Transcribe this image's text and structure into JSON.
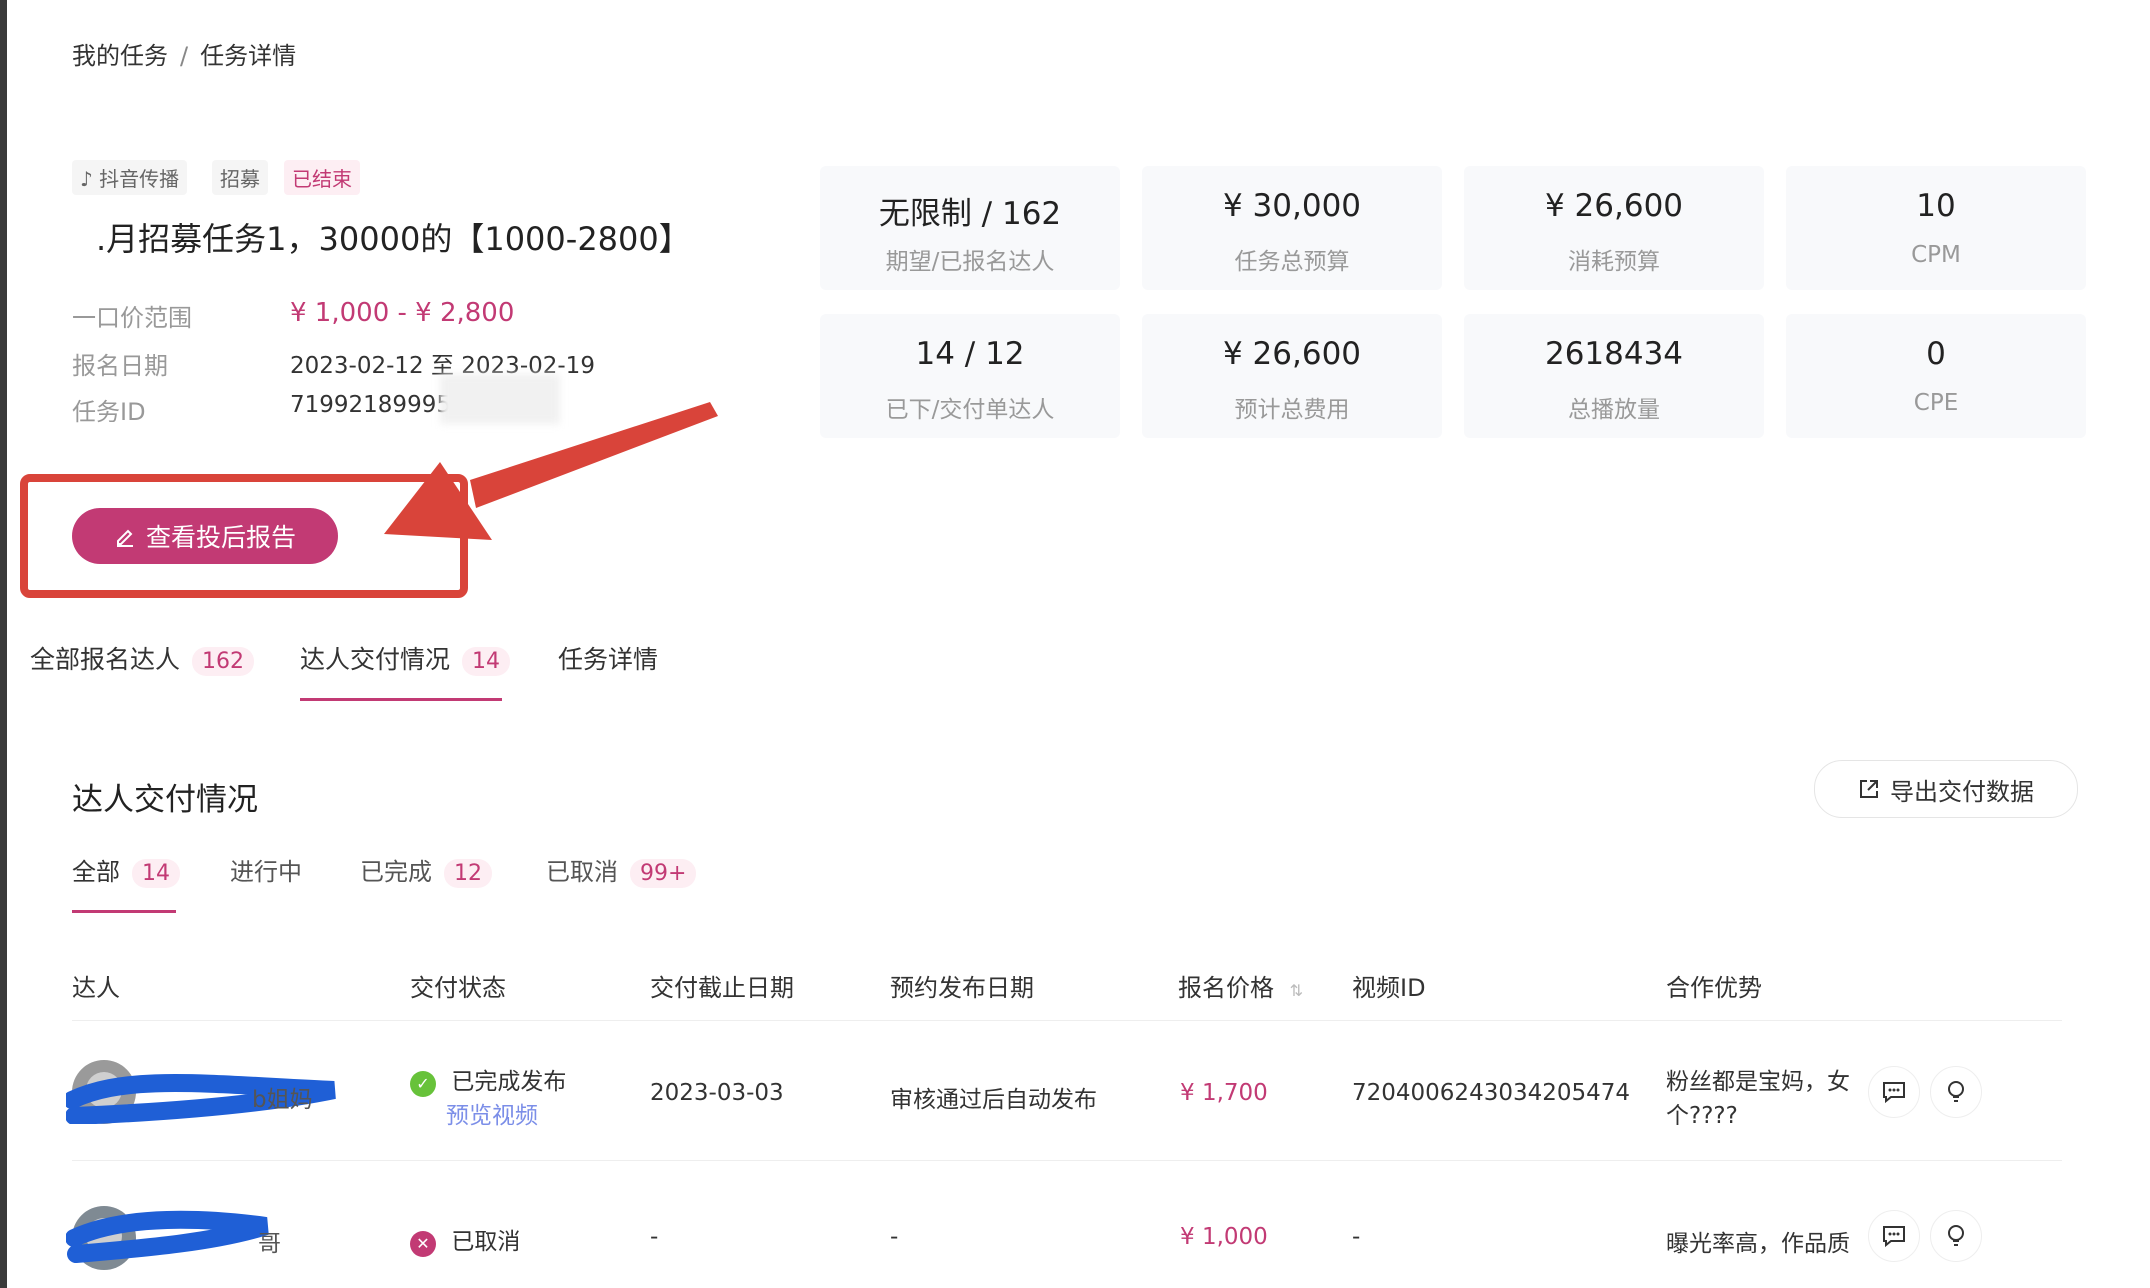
{
  "breadcrumb": {
    "parent": "我的任务",
    "separator": "/",
    "current": "任务详情"
  },
  "task": {
    "tags": {
      "platform": "抖音传播",
      "type": "招募",
      "status": "已结束"
    },
    "title": ".月招募任务1，30000的【1000-2800】",
    "price_range_label": "一口价范围",
    "price_range_value": "¥ 1,000 - ¥ 2,800",
    "signup_date_label": "报名日期",
    "signup_date_value": "2023-02-12 至 2023-02-19",
    "task_id_label": "任务ID",
    "task_id_value": "71992189995"
  },
  "stats": [
    {
      "value": "无限制 / 162",
      "label": "期望/已报名达人"
    },
    {
      "value": "¥ 30,000",
      "label": "任务总预算"
    },
    {
      "value": "¥ 26,600",
      "label": "消耗预算"
    },
    {
      "value": "10",
      "label": "CPM"
    },
    {
      "value": "14 / 12",
      "label": "已下/交付单达人"
    },
    {
      "value": "¥ 26,600",
      "label": "预计总费用"
    },
    {
      "value": "2618434",
      "label": "总播放量"
    },
    {
      "value": "0",
      "label": "CPE"
    }
  ],
  "report_button": {
    "label": "查看投后报告"
  },
  "main_tabs": [
    {
      "label": "全部报名达人",
      "badge": "162"
    },
    {
      "label": "达人交付情况",
      "badge": "14"
    },
    {
      "label": "任务详情",
      "badge": ""
    }
  ],
  "section": {
    "title": "达人交付情况",
    "export_label": "导出交付数据"
  },
  "sub_tabs": [
    {
      "label": "全部",
      "badge": "14"
    },
    {
      "label": "进行中",
      "badge": ""
    },
    {
      "label": "已完成",
      "badge": "12"
    },
    {
      "label": "已取消",
      "badge": "99+"
    }
  ],
  "table": {
    "columns": [
      "达人",
      "交付状态",
      "交付截止日期",
      "预约发布日期",
      "报名价格",
      "视频ID",
      "合作优势"
    ],
    "rows": [
      {
        "name_suffix": "b姐妈",
        "status": "已完成发布",
        "status_link": "预览视频",
        "deadline": "2023-03-03",
        "publish_date": "审核通过后自动发布",
        "price": "¥ 1,700",
        "video_id": "7204006243034205474",
        "advantage_line1": "粉丝都是宝妈，女",
        "advantage_line2": "个????"
      },
      {
        "name_suffix": "哥",
        "status": "已取消",
        "status_link": "",
        "deadline": "-",
        "publish_date": "-",
        "price": "¥ 1,000",
        "video_id": "-",
        "advantage_line1": "曝光率高，作品质",
        "advantage_line2": ""
      }
    ]
  },
  "colors": {
    "accent": "#c23a74",
    "annotation": "#d9443a",
    "success": "#67c23a",
    "cancel": "#c23a74",
    "link": "#7b8ee8"
  },
  "icons": [
    "tiktok-icon",
    "edit-icon",
    "export-icon",
    "sort-icon",
    "check-icon",
    "close-icon",
    "chat-icon",
    "bulb-icon"
  ]
}
